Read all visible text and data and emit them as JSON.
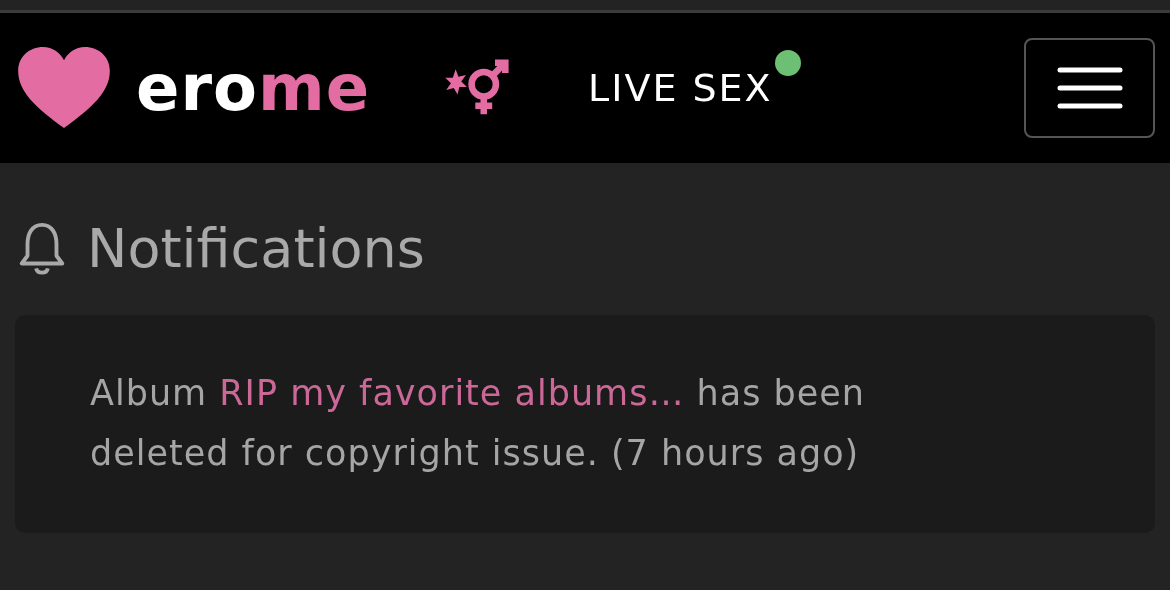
{
  "header": {
    "logo": {
      "text_1": "ero",
      "text_2": "me"
    },
    "live_link": {
      "label": "LIVE SEX",
      "online": true
    }
  },
  "page": {
    "title": "Notifications"
  },
  "notifications": [
    {
      "prefix": "Album",
      "link": "RIP my favorite albums…",
      "suffix": "has been deleted for copyright issue. (7 hours ago)"
    }
  ]
}
